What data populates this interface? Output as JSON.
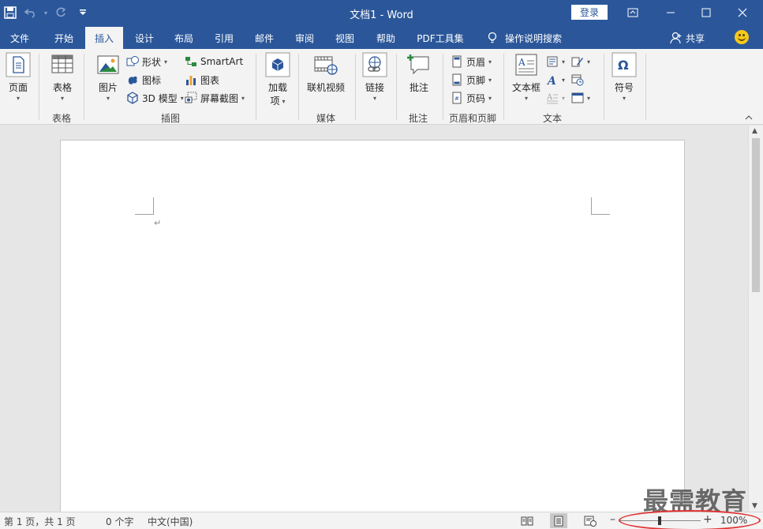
{
  "titlebar": {
    "title": "文档1  -  Word",
    "login_label": "登录"
  },
  "tabs": [
    {
      "label": "文件"
    },
    {
      "label": "开始"
    },
    {
      "label": "插入",
      "active": true
    },
    {
      "label": "设计"
    },
    {
      "label": "布局"
    },
    {
      "label": "引用"
    },
    {
      "label": "邮件"
    },
    {
      "label": "审阅"
    },
    {
      "label": "视图"
    },
    {
      "label": "帮助"
    },
    {
      "label": "PDF工具集"
    },
    {
      "label": "操作说明搜索"
    }
  ],
  "share_label": "共享",
  "ribbon": {
    "pages": {
      "button": "页面",
      "group": ""
    },
    "tables": {
      "button": "表格",
      "group": "表格"
    },
    "illustrations": {
      "group": "插图",
      "picture": "图片",
      "shapes": "形状",
      "icons": "图标",
      "model3d": "3D 模型",
      "smartart": "SmartArt",
      "chart": "图表",
      "screenshot": "屏幕截图"
    },
    "addins": {
      "button_line1": "加载",
      "button_line2": "项"
    },
    "media": {
      "button": "联机视频",
      "group": "媒体"
    },
    "links": {
      "button": "链接"
    },
    "comments": {
      "button": "批注",
      "group": "批注"
    },
    "header_footer": {
      "group": "页眉和页脚",
      "header": "页眉",
      "footer": "页脚",
      "page_number": "页码"
    },
    "text": {
      "group": "文本",
      "textbox": "文本框"
    },
    "symbols": {
      "button": "符号"
    }
  },
  "statusbar": {
    "page_info": "第 1 页，共 1 页",
    "word_count": "0 个字",
    "language": "中文(中国)",
    "zoom_percent": "100%"
  },
  "watermark": "最需教育",
  "colors": {
    "accent": "#2b579a",
    "annotation": "#e03030"
  }
}
